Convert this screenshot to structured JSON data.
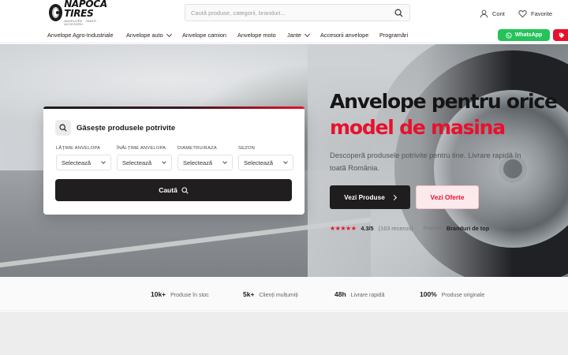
{
  "header": {
    "logo": {
      "name": "NAPOCA TIRES",
      "tagline": "ANVELOPE · JANTE · ACCESORII"
    },
    "search": {
      "placeholder": "Caută produse, categorii, branduri...",
      "icon": "search-icon"
    },
    "account_label": "Cont",
    "favorites_label": "Favorite"
  },
  "nav": {
    "items": [
      {
        "label": "Anvelope Agro-Industriale",
        "dropdown": false
      },
      {
        "label": "Anvelope auto",
        "dropdown": true
      },
      {
        "label": "Anvelope camion",
        "dropdown": false
      },
      {
        "label": "Anvelope moto",
        "dropdown": false
      },
      {
        "label": "Jante",
        "dropdown": true
      },
      {
        "label": "Accesorii anvelope",
        "dropdown": false
      },
      {
        "label": "Programări",
        "dropdown": false
      }
    ],
    "whatsapp_label": "WhatsApp"
  },
  "finder": {
    "title": "Găsește produsele potrivite",
    "fields": [
      {
        "label": "LĂȚIME ANVELOPA",
        "value": "Selectează"
      },
      {
        "label": "ÎNĂLȚIME ANVELOPA",
        "value": "Selectează"
      },
      {
        "label": "DIAMETRU/RAZA",
        "value": "Selectează"
      },
      {
        "label": "SEZON",
        "value": "Selectează"
      }
    ],
    "button_label": "Caută"
  },
  "hero": {
    "title_line1": "Anvelope pentru orice",
    "title_line2": "model de masina",
    "description": "Descoperă produsele potrivite pentru tine. Livrare rapidă în toată România.",
    "primary_button": "Vezi Produse",
    "secondary_button": "Vezi Oferte",
    "rating": {
      "stars": "★★★★★",
      "score": "4.3/5",
      "count": "(163 recenzii)",
      "brands_prefix": "Premium",
      "brands_label": "Branduri de top"
    }
  },
  "stats": [
    {
      "value": "10k+",
      "label": "Produse în stoc"
    },
    {
      "value": "5k+",
      "label": "Clienți mulțumiți"
    },
    {
      "value": "48h",
      "label": "Livrare rapidă"
    },
    {
      "value": "100%",
      "label": "Produse originale"
    }
  ],
  "colors": {
    "accent": "#e8112d",
    "dark": "#1f1d1d",
    "whatsapp": "#25c35a"
  }
}
